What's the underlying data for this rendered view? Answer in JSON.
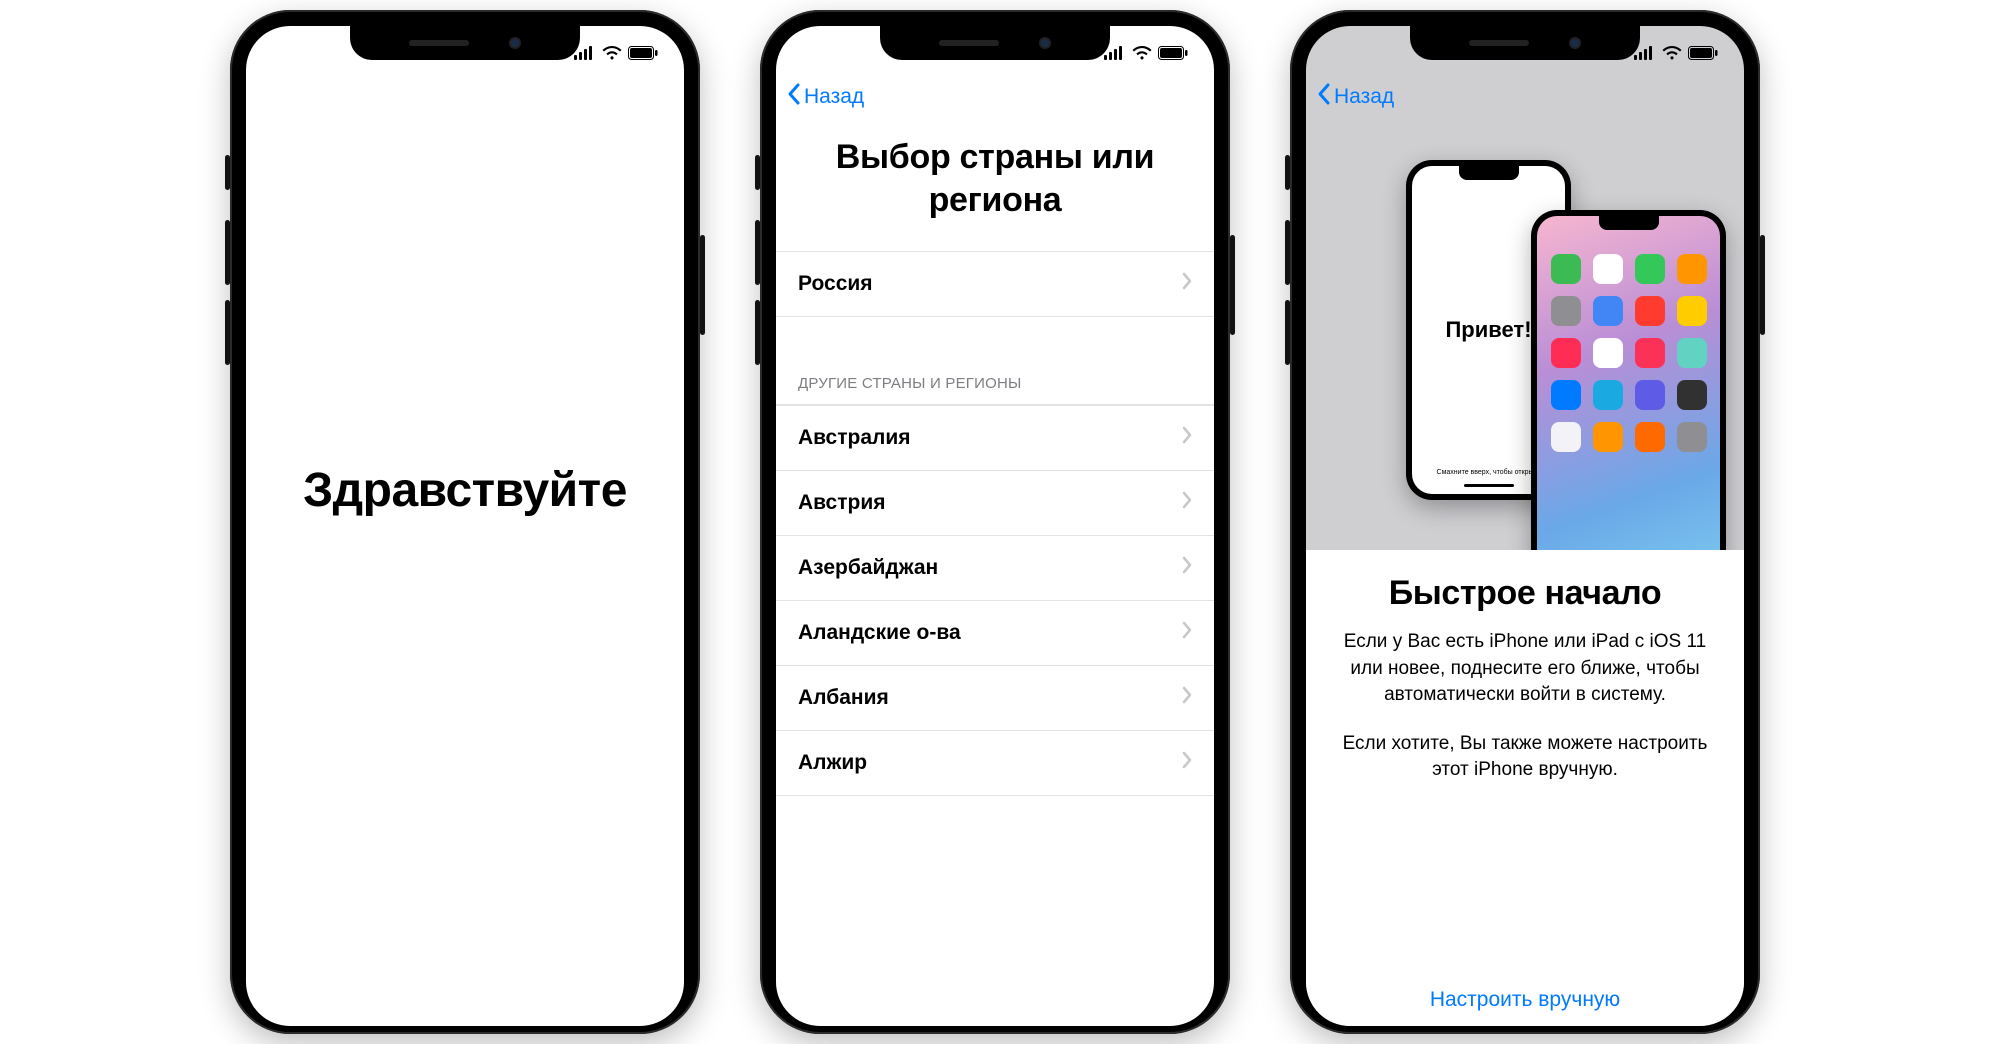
{
  "status": {
    "signal_icon": "signal-icon",
    "wifi_icon": "wifi-icon",
    "battery_icon": "battery-icon"
  },
  "screen1": {
    "greeting": "Здравствуйте"
  },
  "screen2": {
    "back": "Назад",
    "title": "Выбор страны или региона",
    "primary": "Россия",
    "section_header": "ДРУГИЕ СТРАНЫ И РЕГИОНЫ",
    "countries": [
      "Австралия",
      "Австрия",
      "Азербайджан",
      "Аландские о-ва",
      "Албания",
      "Алжир"
    ]
  },
  "screen3": {
    "back": "Назад",
    "hero_greeting": "Привет!",
    "hero_hint": "Смахните вверх, чтобы открыть",
    "title": "Быстрое начало",
    "p1": "Если у Вас есть iPhone или iPad с iOS 11 или новее, поднесите его ближе, чтобы автоматически войти в систему.",
    "p2": "Если хотите, Вы также можете настроить этот iPhone вручную.",
    "manual": "Настроить вручную",
    "app_colors": [
      "#3cba54",
      "#fff",
      "#34c759",
      "#ff9500",
      "#8e8e93",
      "#4285f4",
      "#ff3b30",
      "#ffcc00",
      "#ff2d55",
      "#fff",
      "#fc3158",
      "#62d2c3",
      "#007aff",
      "#1ba9e1",
      "#5e5ce6",
      "#313131",
      "#f2f2f7",
      "#ff9500",
      "#ff6a00",
      "#8e8e93"
    ],
    "dock_colors": [
      "#34c759",
      "#fff",
      "#2f92ee",
      "#fc3158"
    ]
  }
}
